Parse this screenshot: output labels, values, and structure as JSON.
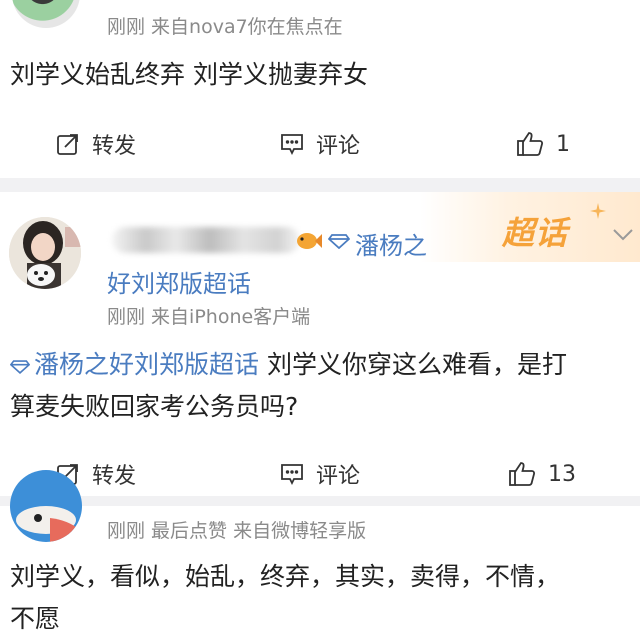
{
  "post1": {
    "meta": "刚刚  来自nova7你在焦点在",
    "content": "刘学义始乱终弃 刘学义抛妻弃女",
    "actions": {
      "repost": "转发",
      "comment": "评论",
      "likes": "1"
    }
  },
  "post2": {
    "username_visible": "潘杨之",
    "username_line2": "好刘郑版超话",
    "badge": "超话",
    "meta": "刚刚  来自iPhone客户端",
    "topic_tag": "潘杨之好刘郑版超话",
    "content_line1": " 刘学义你穿这么难看，是打",
    "content_line2": "算麦失败回家考公务员吗?",
    "actions": {
      "repost": "转发",
      "comment": "评论",
      "likes": "13"
    }
  },
  "post3": {
    "meta": "刚刚  最后点赞  来自微博轻享版",
    "content_line1": "刘学义，看似，始乱，终弃，其实，卖得，不情，",
    "content_line2": "不愿"
  },
  "colors": {
    "link": "#4a7cc0",
    "meta": "#8a8a8a",
    "badge": "#f5a23a",
    "divider": "#f1f1f3"
  },
  "icons": [
    "repost-icon",
    "comment-icon",
    "like-icon",
    "diamond-icon",
    "chevron-down-icon",
    "fish-emoji-icon"
  ]
}
